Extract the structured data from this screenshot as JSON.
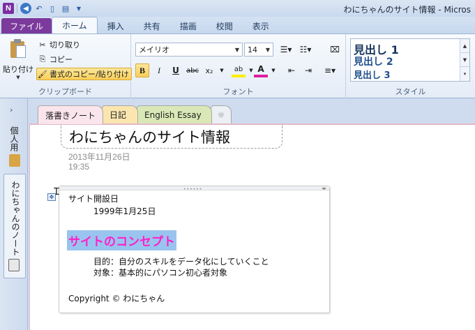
{
  "window": {
    "title": "わにちゃんのサイト情報 - Micros",
    "app_icon": "N"
  },
  "ribbon_tabs": [
    "ファイル",
    "ホーム",
    "挿入",
    "共有",
    "描画",
    "校閲",
    "表示"
  ],
  "clipboard": {
    "paste": "貼り付け",
    "cut": "切り取り",
    "copy": "コピー",
    "format_painter": "書式のコピー/貼り付け",
    "group_label": "クリップボード"
  },
  "font": {
    "name": "メイリオ",
    "size": "14",
    "group_label": "フォント",
    "bold": "B",
    "italic": "I",
    "underline": "U",
    "strike": "abc",
    "subscript": "x₂",
    "highlight": "ab",
    "font_color": "A"
  },
  "styles": {
    "items": [
      "見出し 1",
      "見出し 2",
      "見出し 3"
    ],
    "group_label": "スタイル"
  },
  "nav": {
    "notebooks": [
      "個人用",
      "わにちゃんのノート"
    ]
  },
  "section_tabs": [
    "落書きノート",
    "日記",
    "English Essay",
    "☼"
  ],
  "page": {
    "title": "わにちゃんのサイト情報",
    "date": "2013年11月26日",
    "time": "19:35",
    "content": {
      "label1": "サイト開設日",
      "date_value": "1999年1月25日",
      "heading": "サイトのコンセプト",
      "purpose": "目的：自分のスキルをデータ化にしていくこと",
      "target": "対象：基本的にパソコン初心者対象",
      "copyright": "Copyright  ©  わにちゃん"
    }
  },
  "colors": {
    "file_tab": "#7b3a9c",
    "heading_text": "#ff1fc8",
    "heading_highlight": "#99c4ef",
    "section_active": "#fbe5ec",
    "section_nikki": "#fbe6b0",
    "section_essay": "#d9e8b6"
  }
}
